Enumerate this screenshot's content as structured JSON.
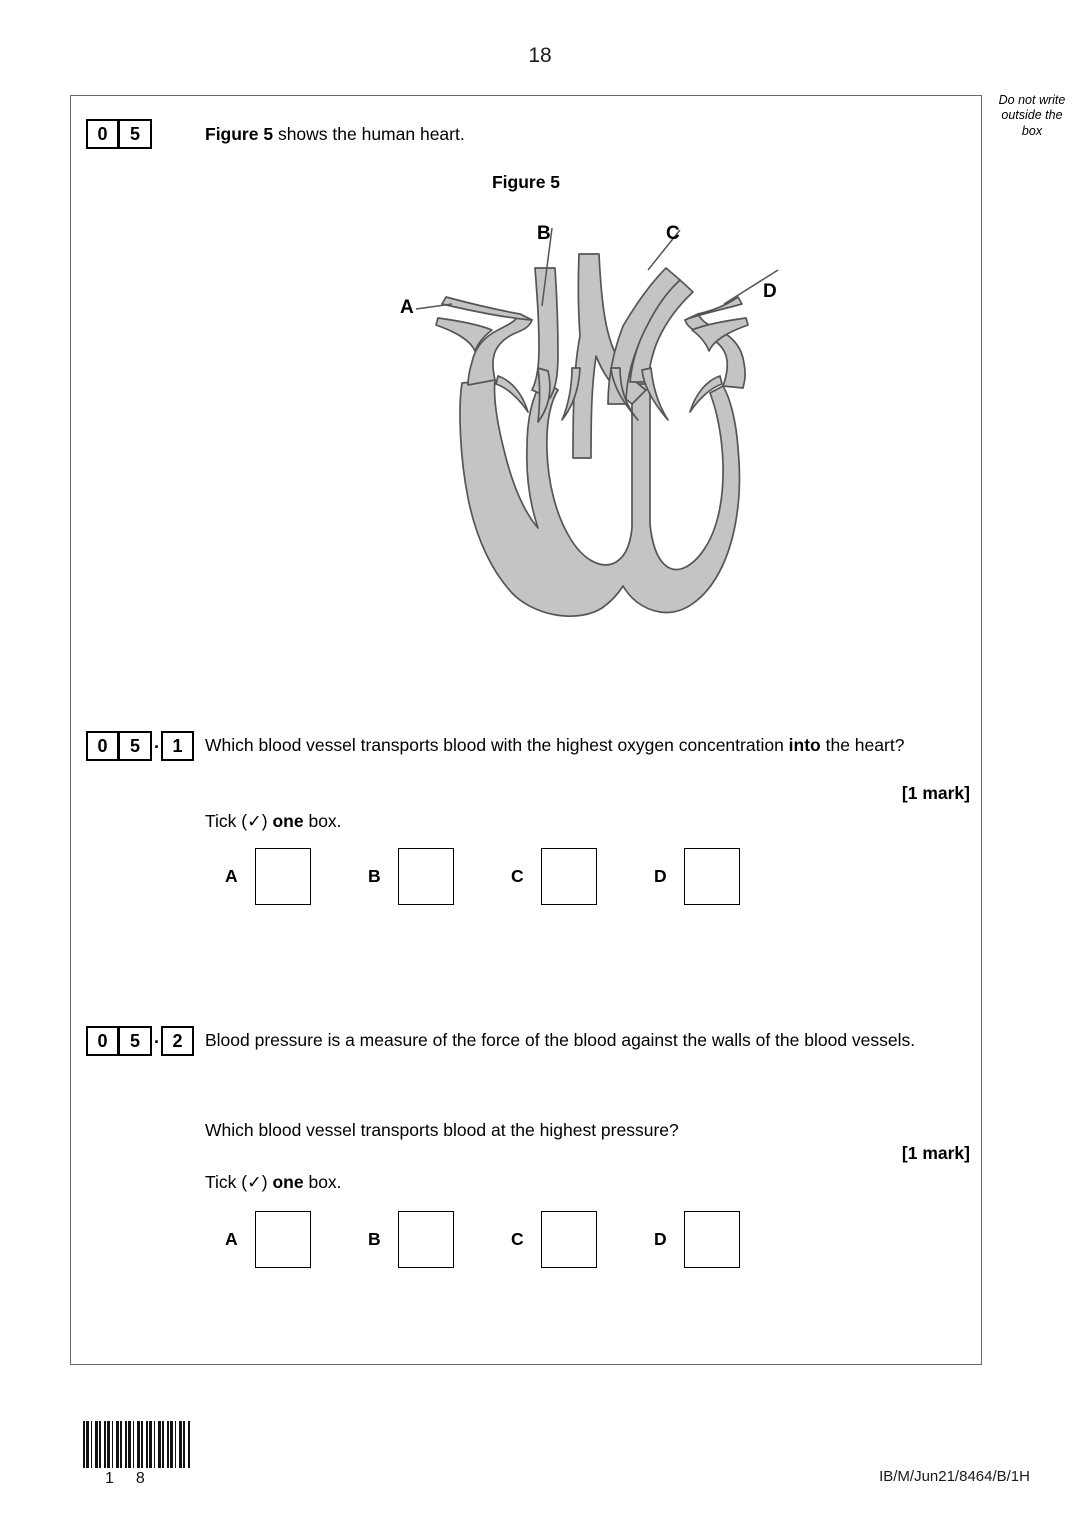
{
  "page": {
    "number": "18",
    "margin_note": "Do not write\noutside the\nbox",
    "margin_note_line1": "Do not write",
    "margin_note_line2": "outside the",
    "margin_note_line3": "box",
    "footer_code": "IB/M/Jun21/8464/B/1H",
    "barcode_digit_1": "1",
    "barcode_digit_2": "8"
  },
  "question_05": {
    "number_digits": [
      "0",
      "5"
    ],
    "stem_bold": "Figure 5",
    "stem_rest": " shows the human heart.",
    "figure_caption": "Figure 5",
    "figure": {
      "type": "labelled-diagram",
      "subject": "human heart cross-section",
      "labels": [
        "A",
        "B",
        "C",
        "D"
      ],
      "fill_color": "#c4c4c4",
      "stroke_color": "#555555"
    }
  },
  "question_05_1": {
    "number_digits": [
      "0",
      "5"
    ],
    "sub_digit": "1",
    "dot": ".",
    "text_part1": "Which blood vessel transports blood with the highest oxygen concentration ",
    "text_bold": "into",
    "text_part2": " the heart?",
    "marks": "[1 mark]",
    "tick_instruction_part1": "Tick (✓) ",
    "tick_instruction_bold": "one",
    "tick_instruction_part2": " box.",
    "options": [
      "A",
      "B",
      "C",
      "D"
    ]
  },
  "question_05_2": {
    "number_digits": [
      "0",
      "5"
    ],
    "sub_digit": "2",
    "dot": ".",
    "text1": "Blood pressure is a measure of the force of the blood against the walls of the blood vessels.",
    "text2": "Which blood vessel transports blood at the highest pressure?",
    "marks": "[1 mark]",
    "tick_instruction_part1": "Tick (✓) ",
    "tick_instruction_bold": "one",
    "tick_instruction_part2": " box.",
    "options": [
      "A",
      "B",
      "C",
      "D"
    ]
  }
}
